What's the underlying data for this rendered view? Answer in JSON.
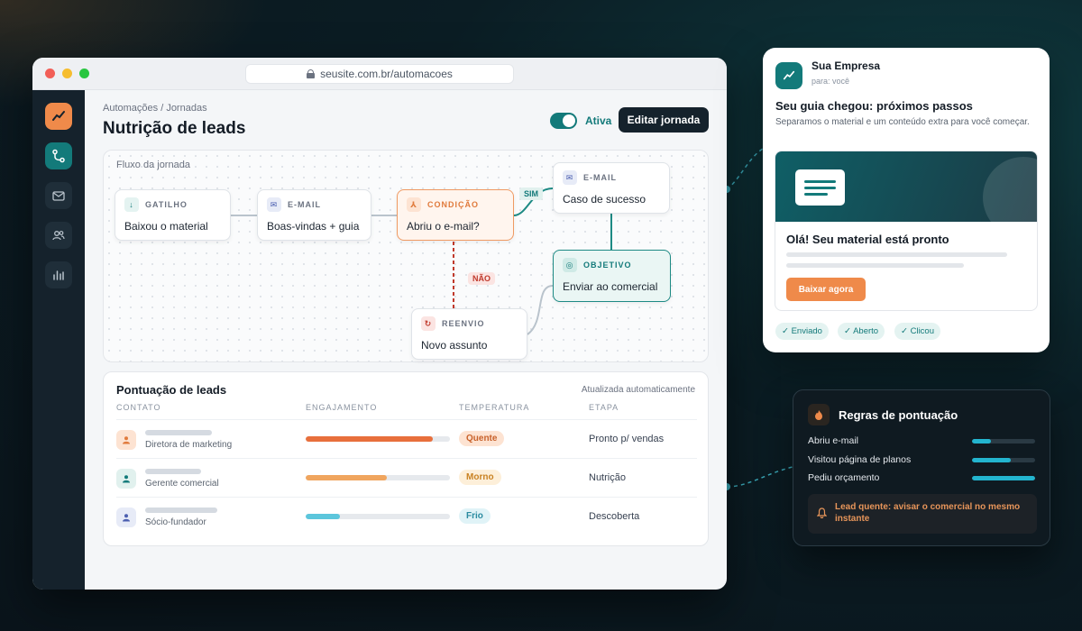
{
  "browser": {
    "url": "seusite.com.br/automacoes"
  },
  "sidebar": {
    "items": [
      {
        "name": "logo",
        "icon": "trend-icon"
      },
      {
        "name": "journeys",
        "icon": "route-icon",
        "active": true
      },
      {
        "name": "email",
        "icon": "mail-icon"
      },
      {
        "name": "contacts",
        "icon": "users-icon"
      },
      {
        "name": "reports",
        "icon": "bar-chart-icon"
      }
    ]
  },
  "header": {
    "breadcrumb": "Automações / Jornadas",
    "title": "Nutrição de leads",
    "toggle_label": "Ativa",
    "edit_button": "Editar jornada"
  },
  "flow": {
    "title": "Fluxo da jornada",
    "nodes": {
      "trigger": {
        "kind": "GATILHO",
        "label": "Baixou o material"
      },
      "email1": {
        "kind": "E-MAIL",
        "label": "Boas-vindas + guia"
      },
      "condition": {
        "kind": "CONDIÇÃO",
        "label": "Abriu o e-mail?"
      },
      "email2": {
        "kind": "E-MAIL",
        "label": "Caso de sucesso"
      },
      "goal": {
        "kind": "OBJETIVO",
        "label": "Enviar ao comercial"
      },
      "resend": {
        "kind": "REENVIO",
        "label": "Novo assunto"
      }
    },
    "yes_tag": "SIM",
    "no_tag": "NÃO"
  },
  "scoring": {
    "title": "Pontuação de leads",
    "updated": "Atualizada automaticamente",
    "columns": [
      "CONTATO",
      "ENGAJAMENTO",
      "TEMPERATURA",
      "ETAPA"
    ],
    "rows": [
      {
        "role": "Diretora de marketing",
        "engagement": 0.88,
        "temperature": "Quente",
        "stage": "Pronto p/ vendas",
        "color": "#e86f3c"
      },
      {
        "role": "Gerente comercial",
        "engagement": 0.56,
        "temperature": "Morno",
        "stage": "Nutrição",
        "color": "#f0a55e"
      },
      {
        "role": "Sócio-fundador",
        "engagement": 0.24,
        "temperature": "Frio",
        "stage": "Descoberta",
        "color": "#5cc6dc"
      }
    ]
  },
  "email": {
    "brand": "Sua Empresa",
    "to": "para: você",
    "subject": "Seu guia chegou: próximos passos",
    "preview": "Separamos o material e um conteúdo extra para você começar.",
    "hero_heading": "Olá! Seu material está pronto",
    "cta": "Baixar agora",
    "statuses": [
      "✓ Enviado",
      "✓ Aberto",
      "✓ Clicou"
    ]
  },
  "rules": {
    "title": "Regras de pontuação",
    "items": [
      {
        "label": "Abriu e-mail",
        "level": 0.3
      },
      {
        "label": "Visitou página de planos",
        "level": 0.62
      },
      {
        "label": "Pediu orçamento",
        "level": 1.0
      }
    ],
    "alert": "Lead quente: avisar o comercial no mesmo instante"
  },
  "colors": {
    "accent": "#137a7a",
    "orange": "#ef8a4a",
    "dark": "#15222c"
  }
}
